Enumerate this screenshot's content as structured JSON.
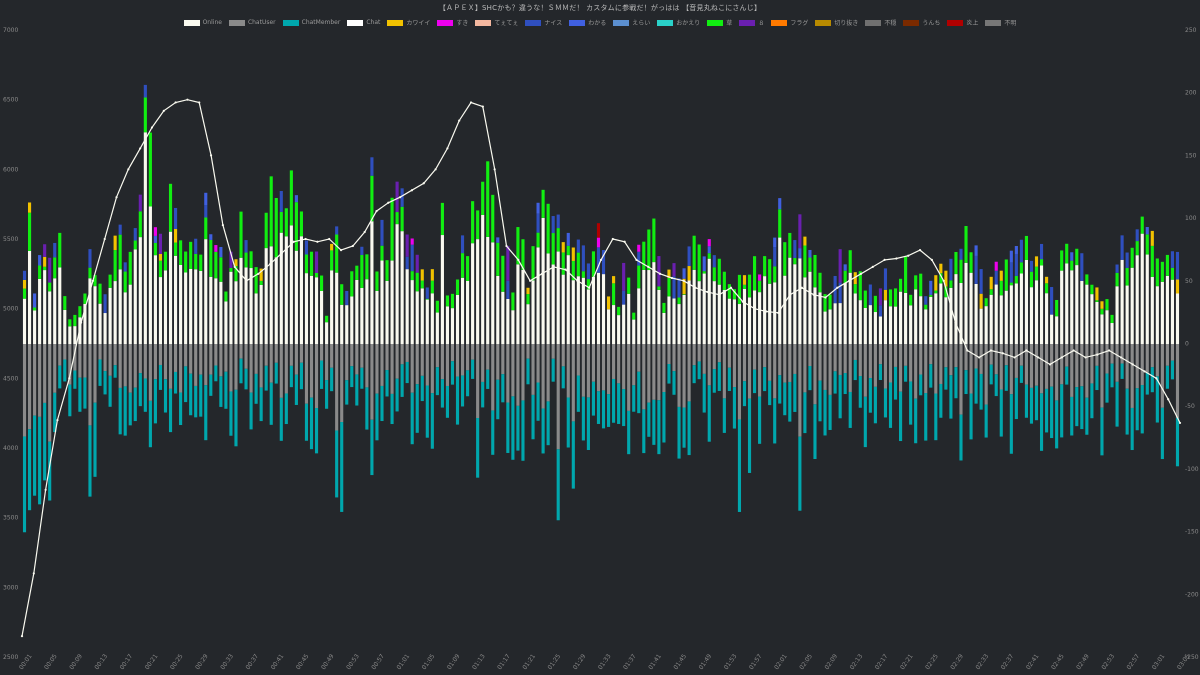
{
  "page": {
    "title": "【ＡＰＥＸ】SHCかも？違うな！ＳＭＭだ！ カスタムに参戦だ！がっはは 【音見丸ねこにさんじ】"
  },
  "legend": [
    {
      "label": "Online",
      "color": "#fafaf0"
    },
    {
      "label": "ChatUser",
      "color": "#8a8a8a"
    },
    {
      "label": "ChatMember",
      "color": "#00a7ad"
    },
    {
      "label": "Chat",
      "color": "#ffffff"
    },
    {
      "label": "カワイイ",
      "color": "#f2c200"
    },
    {
      "label": "すき",
      "color": "#ee00ee"
    },
    {
      "label": "てぇてぇ",
      "color": "#f4b8a0"
    },
    {
      "label": "ナイス",
      "color": "#2f4fbf"
    },
    {
      "label": "わかる",
      "color": "#4060e0"
    },
    {
      "label": "えらい",
      "color": "#5b8fd0"
    },
    {
      "label": "おかえり",
      "color": "#2ad1c9"
    },
    {
      "label": "草",
      "color": "#11ee11"
    },
    {
      "label": "８",
      "color": "#6a1fb0"
    },
    {
      "label": "フラグ",
      "color": "#ff7a00"
    },
    {
      "label": "切り抜き",
      "color": "#b88a00"
    },
    {
      "label": "不穏",
      "color": "#707070"
    },
    {
      "label": "うんち",
      "color": "#7a2a00"
    },
    {
      "label": "炎上",
      "color": "#b00000"
    },
    {
      "label": "不明",
      "color": "#777777"
    }
  ],
  "chart_data": {
    "type": "bar",
    "title": "【ＡＰＥＸ】SHCかも？違うな！ＳＭＭだ！ カスタムに参戦だ！がっはは 【音見丸ねこにさんじ】",
    "left_axis": {
      "ticks": [
        2500,
        3000,
        3500,
        4000,
        4500,
        5000,
        5500,
        6000,
        6500,
        7000
      ],
      "range": [
        2500,
        7000
      ]
    },
    "right_axis": {
      "ticks": [
        -250,
        -200,
        -150,
        -100,
        -50,
        0,
        50,
        100,
        150,
        200,
        250
      ],
      "range": [
        -250,
        250
      ]
    },
    "x_labels": [
      "00:01",
      "00:05",
      "00:09",
      "00:13",
      "00:17",
      "00:21",
      "00:25",
      "00:29",
      "00:33",
      "00:37",
      "00:41",
      "00:45",
      "00:49",
      "00:53",
      "00:57",
      "01:01",
      "01:05",
      "01:09",
      "01:13",
      "01:17",
      "01:21",
      "01:25",
      "01:29",
      "01:33",
      "01:37",
      "01:41",
      "01:45",
      "01:49",
      "01:53",
      "01:57",
      "02:01",
      "02:05",
      "02:09",
      "02:13",
      "02:17",
      "02:21",
      "02:25",
      "02:29",
      "02:33",
      "02:37",
      "02:41",
      "02:45",
      "02:49",
      "02:53",
      "02:57",
      "03:01",
      "03:05"
    ],
    "online": [
      2650,
      3100,
      3700,
      4200,
      4500,
      4900,
      5200,
      5500,
      5800,
      6000,
      6150,
      6300,
      6420,
      6480,
      6500,
      6480,
      6100,
      5600,
      5300,
      5200,
      5250,
      5320,
      5400,
      5480,
      5500,
      5480,
      5500,
      5420,
      5450,
      5550,
      5700,
      5760,
      5800,
      5850,
      5900,
      6000,
      6150,
      6350,
      6480,
      6450,
      6000,
      5450,
      5350,
      5200,
      5250,
      5300,
      5280,
      5200,
      5150,
      5350,
      5500,
      5480,
      5350,
      5300,
      5250,
      5220,
      5200,
      5150,
      5120,
      5100,
      5150,
      5050,
      5000,
      4980,
      4970,
      5100,
      5150,
      5100,
      5080,
      5150,
      5200,
      5250,
      5300,
      5350,
      5360,
      5380,
      5420,
      5350,
      5200,
      4900,
      4700,
      4650,
      4700,
      4680,
      4650,
      4700,
      4650,
      4600,
      4650,
      4700,
      4650,
      4670,
      4700,
      4650,
      4600,
      4550,
      4500,
      4350,
      4180
    ],
    "bars": {
      "count": 230,
      "chat_plus": [
        60,
        120,
        40,
        75,
        80,
        70,
        85,
        90,
        40,
        20,
        25,
        30,
        45,
        80,
        60,
        50,
        35,
        60,
        90,
        95,
        70,
        80,
        95,
        120,
        215,
        180,
        95,
        90,
        75,
        150,
        110,
        95,
        80,
        85,
        90,
        75,
        130,
        95,
        85,
        80,
        45,
        75,
        70,
        120,
        90,
        80,
        65,
        60,
        110,
        140,
        120,
        130,
        120,
        140,
        130,
        110,
        90,
        85,
        75,
        60,
        25,
        80,
        100,
        55,
        40,
        60,
        65,
        80,
        75,
        150,
        60,
        100,
        75,
        120,
        130,
        125,
        80,
        85,
        75,
        60,
        45,
        60,
        35,
        120,
        40,
        40,
        55,
        90,
        75,
        115,
        110,
        140,
        150,
        125,
        85,
        70,
        50,
        45,
        95,
        95,
        45,
        90,
        120,
        130,
        120,
        110,
        115,
        90,
        90,
        80,
        95,
        80,
        65,
        75,
        80,
        70,
        35,
        55,
        30,
        40,
        55,
        25,
        80,
        90,
        95,
        100,
        70,
        35,
        60,
        60,
        55,
        60,
        65,
        90,
        80,
        70,
        85,
        75,
        70,
        60,
        50,
        45,
        55,
        55,
        65,
        70,
        60,
        80,
        75,
        85,
        120,
        95,
        100,
        85,
        90,
        95,
        80,
        75,
        60,
        45,
        40,
        50,
        55,
        65,
        75,
        60,
        60,
        50,
        40,
        45,
        35,
        45,
        50,
        45,
        55,
        70,
        40,
        55,
        60,
        40,
        50,
        55,
        65,
        60,
        70,
        75,
        80,
        95,
        80,
        65,
        50,
        40,
        55,
        60,
        65,
        70,
        75,
        80,
        85,
        95,
        70,
        75,
        80,
        55,
        40,
        35,
        75,
        90,
        75,
        80,
        65,
        60,
        50,
        45,
        35,
        40,
        25,
        70,
        85,
        80,
        80,
        95,
        110,
        95,
        90,
        70,
        70,
        80,
        75,
        65,
        60,
        80,
        110,
        140,
        160,
        180,
        185,
        170,
        140,
        115,
        85,
        65,
        30,
        25,
        20,
        15
      ]
    }
  }
}
